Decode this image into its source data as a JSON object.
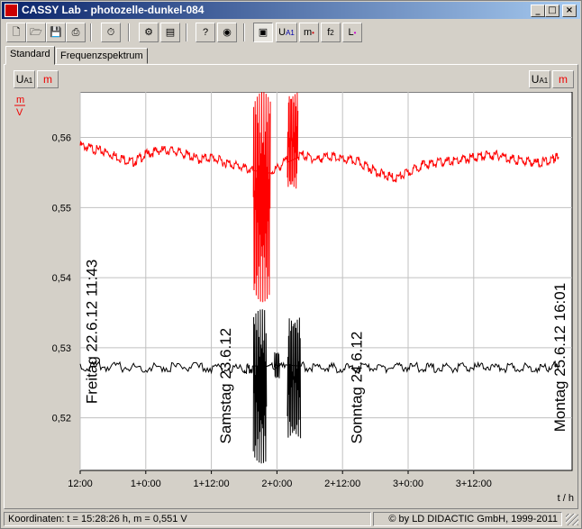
{
  "window": {
    "title": "CASSY Lab - photozelle-dunkel-084",
    "caption_buttons": [
      "_",
      "□",
      "×"
    ]
  },
  "toolbar": {
    "buttons": [
      {
        "name": "new",
        "glyph": "🗋"
      },
      {
        "name": "open",
        "glyph": "🗁"
      },
      {
        "name": "save",
        "glyph": "💾"
      },
      {
        "name": "print",
        "glyph": "⎙"
      },
      {
        "name": "measure-timer",
        "glyph": "⏱"
      },
      {
        "name": "settings",
        "glyph": "⚙"
      },
      {
        "name": "table",
        "glyph": "▤"
      },
      {
        "name": "help",
        "glyph": "?"
      },
      {
        "name": "sensor",
        "glyph": "◉"
      },
      {
        "name": "display",
        "glyph": "▣"
      }
    ],
    "channel_buttons": [
      {
        "label": "U",
        "sub": "A1"
      },
      {
        "label": "m",
        "sub": ""
      },
      {
        "label": "f",
        "sub": "2"
      },
      {
        "label": "L",
        "sub": ""
      }
    ]
  },
  "tabs": [
    {
      "label": "Standard",
      "active": true
    },
    {
      "label": "Frequenzspektrum",
      "active": false
    }
  ],
  "axis_buttons": {
    "left": [
      {
        "label": "U",
        "sub": "A1"
      },
      {
        "label": "m",
        "sub": ""
      }
    ],
    "right": [
      {
        "label": "U",
        "sub": "A1"
      },
      {
        "label": "m",
        "sub": ""
      }
    ]
  },
  "statusbar": {
    "coords": "Koordinaten:  t = 15:28:26 h,   m = 0,551 V",
    "copyright": "© by LD DIDACTIC GmbH, 1999-2011"
  },
  "colors": {
    "series_m": "#ff0000",
    "series_u": "#000000",
    "grid": "#c0c0c0"
  },
  "chart_data": {
    "type": "line",
    "y_unit_label": [
      "m",
      "V"
    ],
    "xlabel": "t / h",
    "xlim": [
      0,
      3.75
    ],
    "ylim": [
      0.5125,
      0.5665
    ],
    "x_ticks": [
      {
        "v": 0,
        "label": "12:00"
      },
      {
        "v": 0.5,
        "label": "1+0:00"
      },
      {
        "v": 1,
        "label": "1+12:00"
      },
      {
        "v": 1.5,
        "label": "2+0:00"
      },
      {
        "v": 2,
        "label": "2+12:00"
      },
      {
        "v": 2.5,
        "label": "3+0:00"
      },
      {
        "v": 3,
        "label": "3+12:00"
      }
    ],
    "y_ticks": [
      {
        "v": 0.52,
        "label": "0,52"
      },
      {
        "v": 0.53,
        "label": "0,53"
      },
      {
        "v": 0.54,
        "label": "0,54"
      },
      {
        "v": 0.55,
        "label": "0,55"
      },
      {
        "v": 0.56,
        "label": "0,56"
      }
    ],
    "annotations": [
      {
        "text": "Freitag 22.6.12 11:43",
        "x": 0.03,
        "y": 0.522
      },
      {
        "text": "Samstag 23.6.12",
        "x": 1.05,
        "y": 0.5163
      },
      {
        "text": "Sonntag 24.6.12",
        "x": 2.05,
        "y": 0.5163
      },
      {
        "text": "Montag 25.6.12 16:01",
        "x": 3.6,
        "y": 0.518
      }
    ],
    "series": [
      {
        "name": "m",
        "color": "#ff0000",
        "x": [
          0.0,
          0.1,
          0.2,
          0.3,
          0.4,
          0.5,
          0.6,
          0.7,
          0.8,
          0.9,
          1.0,
          1.1,
          1.2,
          1.3,
          1.4,
          1.5,
          1.6,
          1.7,
          1.8,
          1.9,
          2.0,
          2.1,
          2.2,
          2.3,
          2.4,
          2.5,
          2.6,
          2.7,
          2.8,
          2.9,
          3.0,
          3.1,
          3.2,
          3.3,
          3.4,
          3.5,
          3.6,
          3.65
        ],
        "y": [
          0.5592,
          0.5587,
          0.5582,
          0.5575,
          0.5568,
          0.5579,
          0.5585,
          0.5585,
          0.558,
          0.5572,
          0.5575,
          0.5568,
          0.5563,
          0.5557,
          0.555,
          0.5559,
          0.5575,
          0.5578,
          0.5572,
          0.5577,
          0.5572,
          0.557,
          0.5561,
          0.5551,
          0.5545,
          0.5553,
          0.5564,
          0.5567,
          0.5569,
          0.5571,
          0.5575,
          0.5578,
          0.5578,
          0.5572,
          0.557,
          0.5567,
          0.5572,
          0.558
        ],
        "bursts": [
          {
            "x_from": 1.32,
            "x_to": 1.45,
            "y_min": 0.5365,
            "y_max": 0.5665
          },
          {
            "x_from": 1.58,
            "x_to": 1.66,
            "y_min": 0.5525,
            "y_max": 0.5665
          }
        ]
      },
      {
        "name": "U",
        "color": "#000000",
        "x": [
          0.0,
          0.25,
          0.5,
          0.75,
          1.0,
          1.25,
          1.32,
          1.5,
          1.7,
          1.9,
          2.1,
          2.3,
          2.5,
          2.7,
          2.9,
          3.1,
          3.3,
          3.5,
          3.65
        ],
        "y": [
          0.5277,
          0.5276,
          0.5275,
          0.5276,
          0.5275,
          0.5273,
          0.5274,
          0.5275,
          0.5276,
          0.5275,
          0.5274,
          0.5275,
          0.5276,
          0.5275,
          0.5275,
          0.5276,
          0.5275,
          0.5275,
          0.5277
        ],
        "bursts": [
          {
            "x_from": 1.32,
            "x_to": 1.42,
            "y_min": 0.5135,
            "y_max": 0.5355
          },
          {
            "x_from": 1.48,
            "x_to": 1.52,
            "y_min": 0.5255,
            "y_max": 0.5295
          },
          {
            "x_from": 1.58,
            "x_to": 1.68,
            "y_min": 0.517,
            "y_max": 0.5345
          }
        ]
      }
    ]
  }
}
